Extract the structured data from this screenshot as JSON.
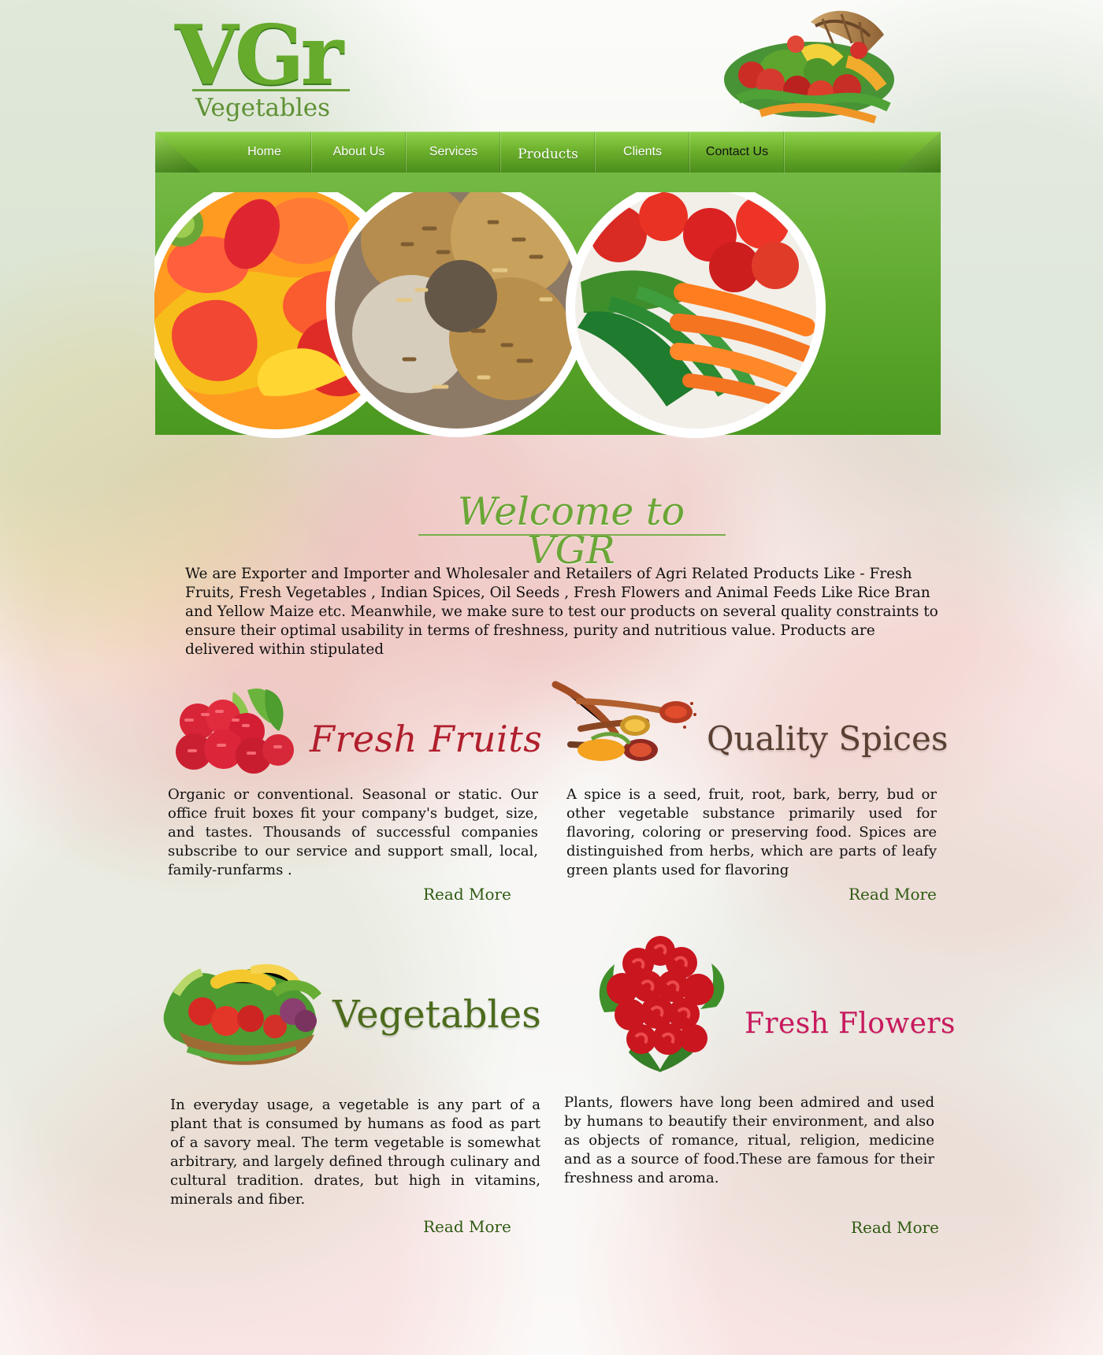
{
  "logo": {
    "mark": "VGr",
    "subtitle": "Vegetables"
  },
  "nav": {
    "items": [
      {
        "label": "Home"
      },
      {
        "label": "About Us"
      },
      {
        "label": "Services"
      },
      {
        "label": "Products"
      },
      {
        "label": "Clients"
      },
      {
        "label": "Contact Us"
      }
    ]
  },
  "welcome": {
    "title": "Welcome to VGR",
    "body": "We are Exporter and Importer and Wholesaler and Retailers of Agri Related Products Like - Fresh Fruits, Fresh Vegetables , Indian Spices, Oil Seeds , Fresh Flowers and Animal Feeds Like Rice Bran and Yellow Maize etc. Meanwhile, we make sure to test our products on several quality constraints to ensure their optimal usability in terms of freshness, purity and nutritious value. Products are delivered within stipulated"
  },
  "sections": {
    "fruits": {
      "title": "Fresh Fruits",
      "text": "Organic or conventional. Seasonal or static. Our office fruit boxes fit your company's budget, size, and tastes. Thousands of successful companies subscribe to our service and support small, local, family-runfarms .",
      "read_more": "Read  More"
    },
    "spices": {
      "title": "Quality Spices",
      "text": "A spice is a seed, fruit, root, bark, berry, bud or other vegetable substance primarily used for flavoring, coloring or preserving food. Spices are distinguished from herbs, which are parts of leafy green plants used for flavoring",
      "read_more": "Read  More"
    },
    "vegetables": {
      "title": "Vegetables",
      "text": "In everyday usage, a vegetable is any part of a plant that is consumed by humans as food as part of a savory meal. The term vegetable is somewhat arbitrary, and largely defined through culinary and cultural tradition. drates, but high in vitamins, minerals and fiber.",
      "read_more": "Read  More"
    },
    "flowers": {
      "title": "Fresh Flowers",
      "text": "Plants, flowers have long been admired and used by humans to beautify their environment, and also as objects of romance, ritual, religion, medicine and as a source of food.These are famous for their freshness and aroma.",
      "read_more": "Read  More"
    }
  },
  "colors": {
    "brand_green": "#6ba637",
    "nav_green": "#6eb12d",
    "link_green": "#2f5a12",
    "fruit_red": "#b01f2d",
    "flower_pink": "#c9195e",
    "text": "#111111"
  }
}
